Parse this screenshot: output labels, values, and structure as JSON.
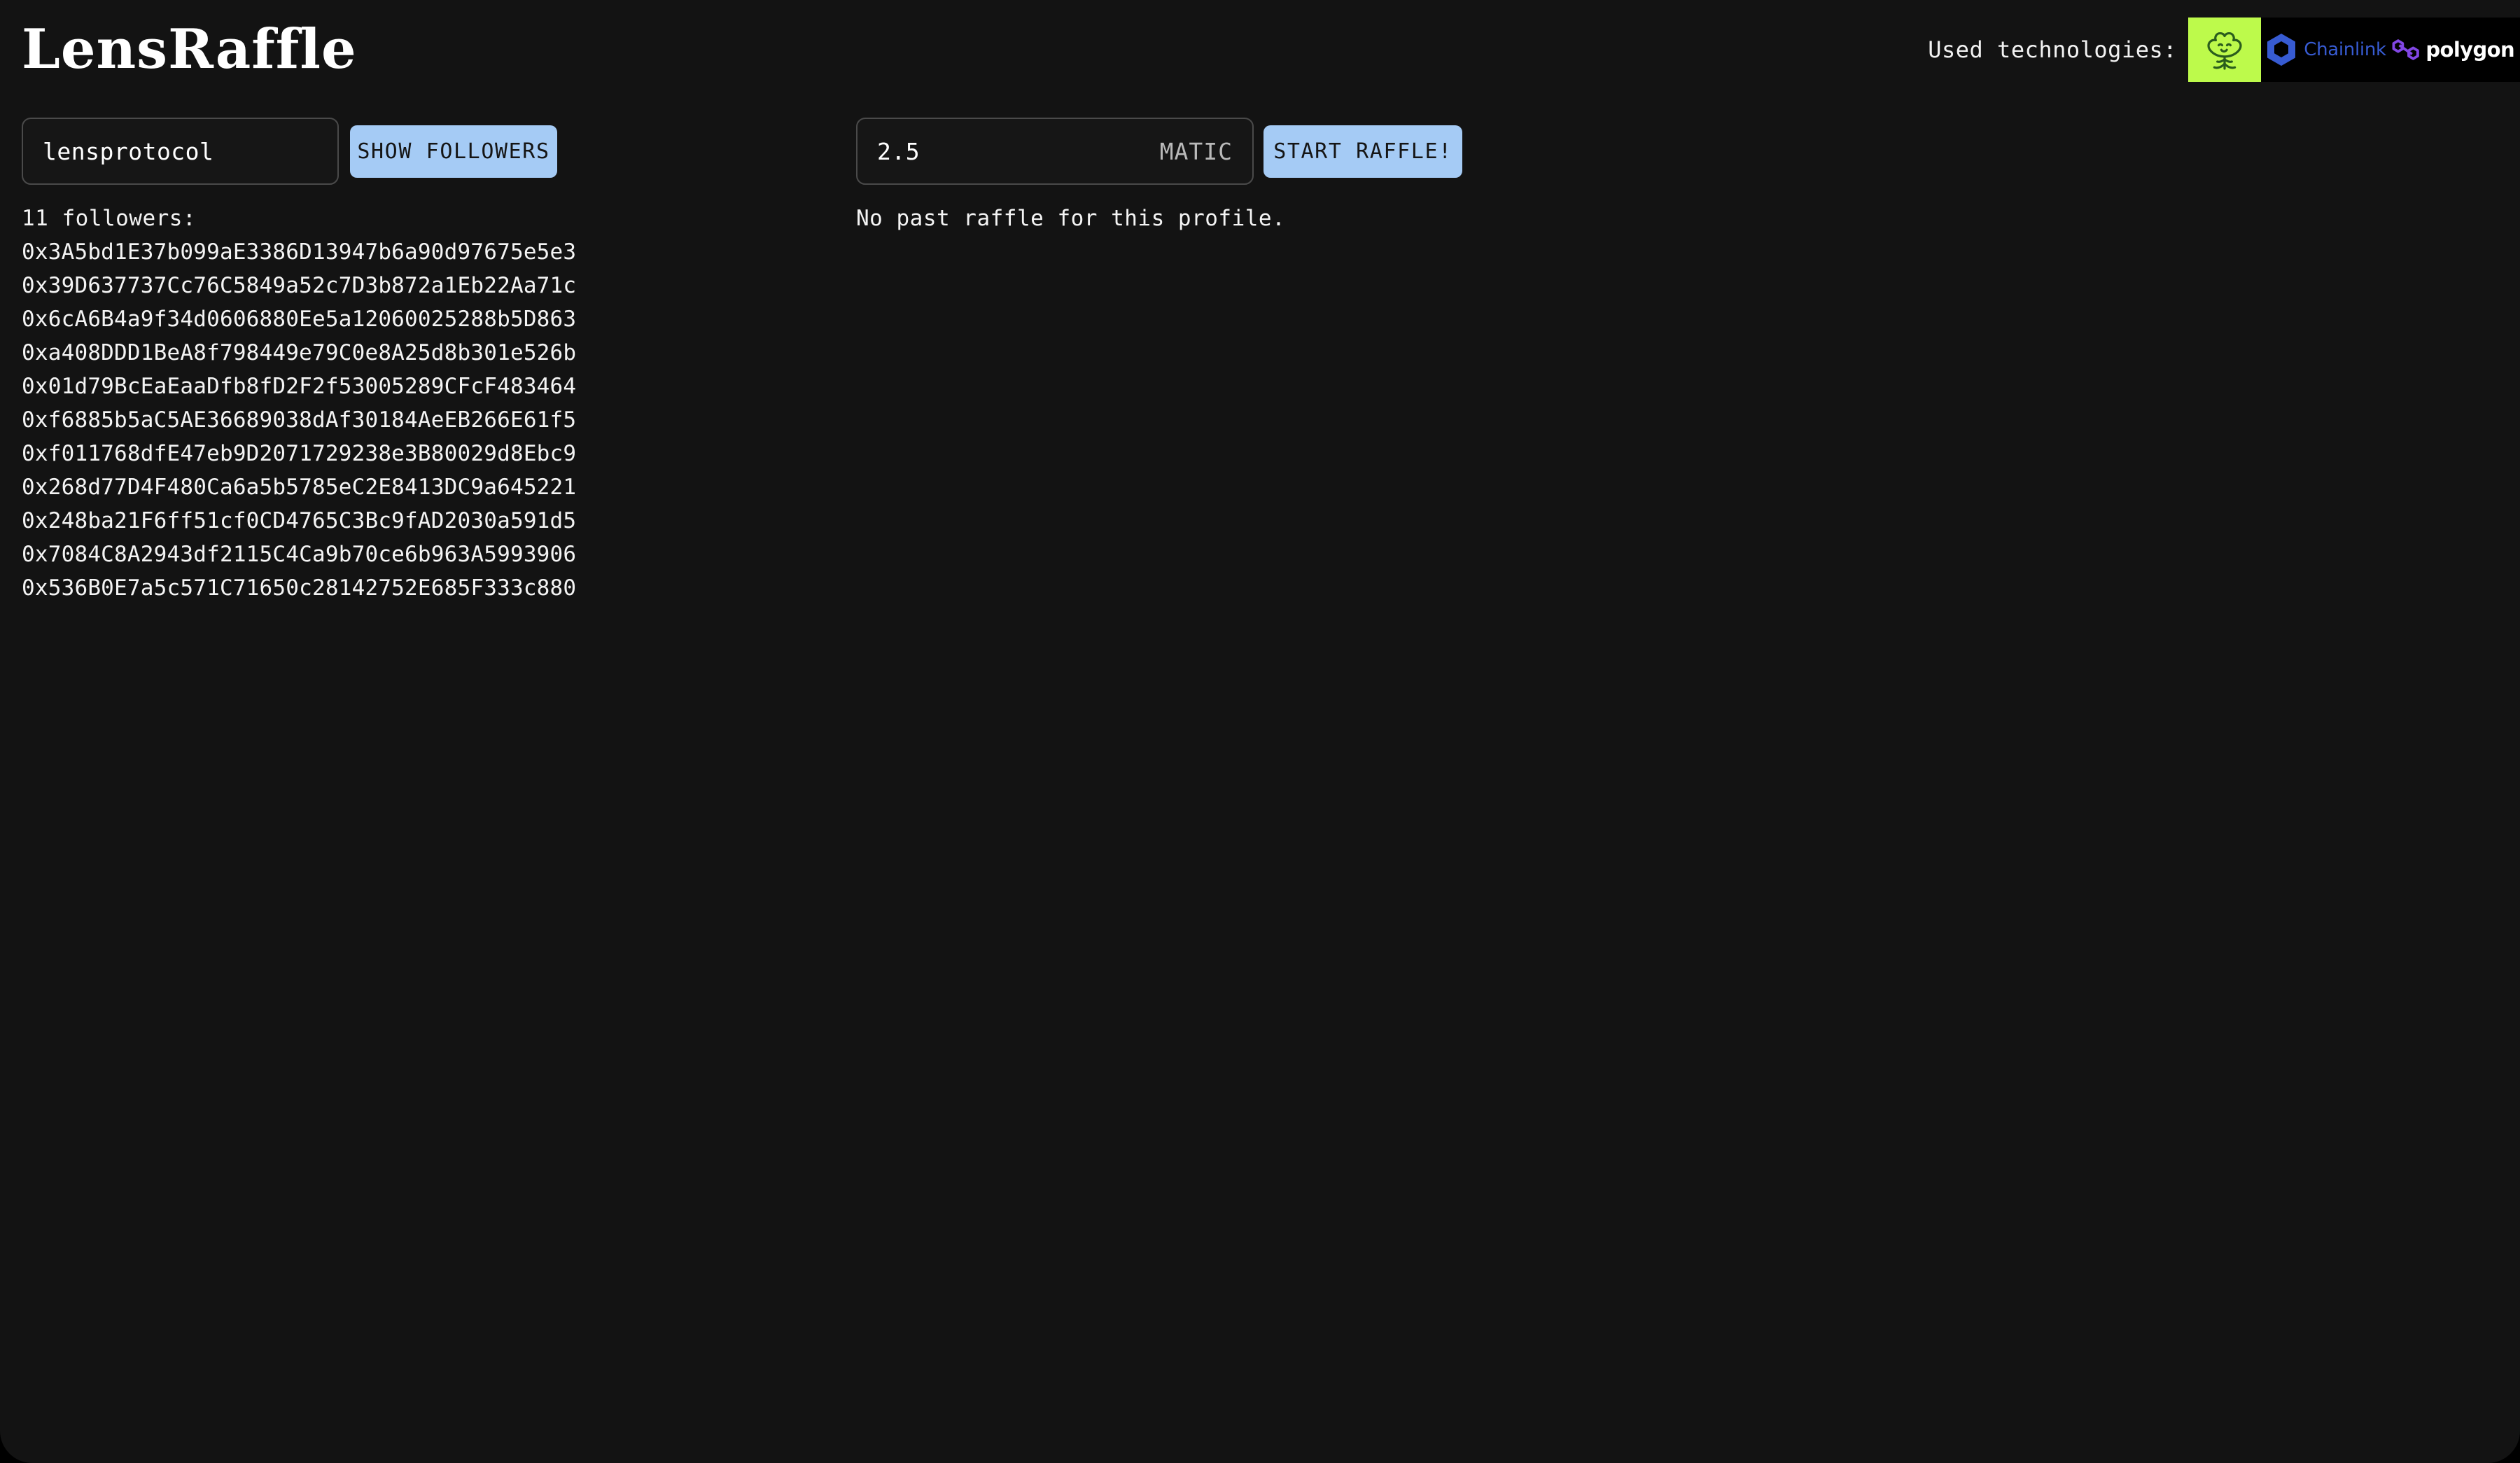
{
  "app": {
    "title": "LensRaffle",
    "background_color": "#131313",
    "accent_button_color": "#a5cbf5"
  },
  "technologies": {
    "label": "Used technologies:",
    "items": [
      {
        "name": "lens-protocol",
        "wordmark": "",
        "tile_color": "#bdfa4b",
        "mark_color": "#2a5d1d"
      },
      {
        "name": "chainlink",
        "wordmark": "Chainlink",
        "tile_color": "#000000",
        "mark_color": "#375bd2"
      },
      {
        "name": "polygon",
        "wordmark": "polygon",
        "tile_color": "#000000",
        "mark_color": "#8247e5"
      }
    ]
  },
  "handle_form": {
    "value": "lensprotocol",
    "placeholder": "lensprotocol",
    "button_label": "SHOW FOLLOWERS"
  },
  "raffle_form": {
    "amount_value": "2.5",
    "amount_placeholder": "2.5",
    "currency": "MATIC",
    "button_label": "START RAFFLE!"
  },
  "followers": {
    "count_label": "11 followers:",
    "count": 11,
    "addresses": [
      "0x3A5bd1E37b099aE3386D13947b6a90d97675e5e3",
      "0x39D637737Cc76C5849a52c7D3b872a1Eb22Aa71c",
      "0x6cA6B4a9f34d0606880Ee5a12060025288b5D863",
      "0xa408DDD1BeA8f798449e79C0e8A25d8b301e526b",
      "0x01d79BcEaEaaDfb8fD2F2f53005289CFcF483464",
      "0xf6885b5aC5AE36689038dAf30184AeEB266E61f5",
      "0xf011768dfE47eb9D2071729238e3B80029d8Ebc9",
      "0x268d77D4F480Ca6a5b5785eC2E8413DC9a645221",
      "0x248ba21F6ff51cf0CD4765C3Bc9fAD2030a591d5",
      "0x7084C8A2943df2115C4Ca9b70ce6b963A5993906",
      "0x536B0E7a5c571C71650c28142752E685F333c880"
    ]
  },
  "raffle_status": {
    "message": "No past raffle for this profile."
  }
}
